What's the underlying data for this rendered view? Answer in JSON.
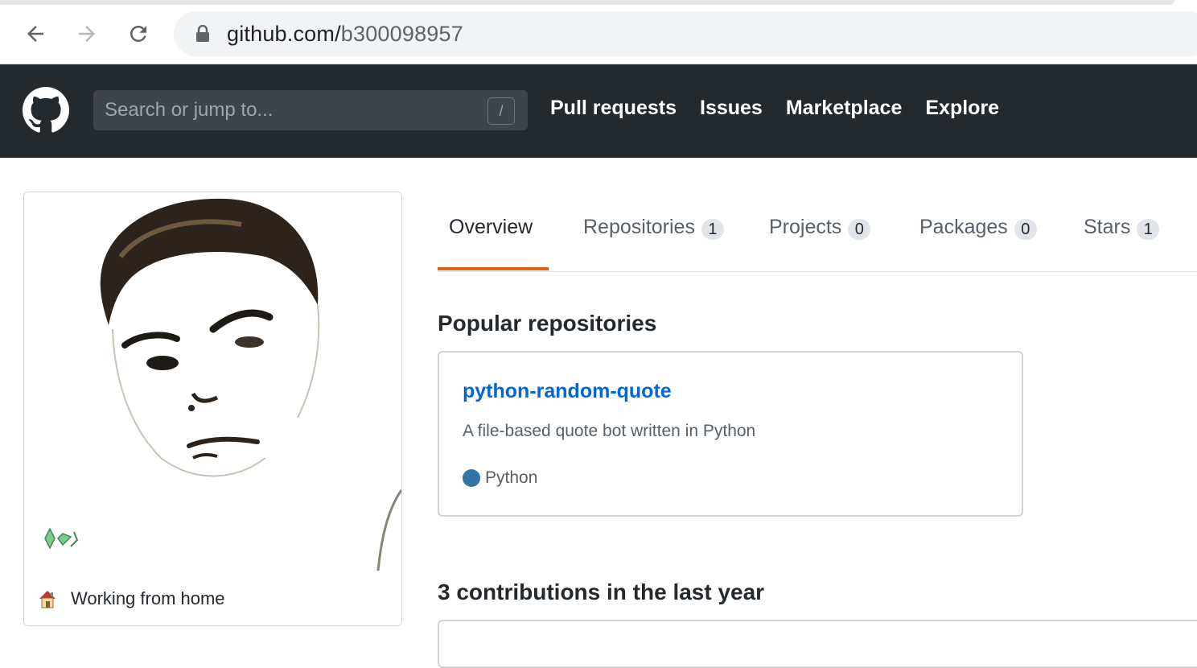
{
  "browser": {
    "url_host": "github.com/",
    "url_path": "b300098957"
  },
  "header": {
    "search_placeholder": "Search or jump to...",
    "search_shortcut": "/",
    "nav": [
      "Pull requests",
      "Issues",
      "Marketplace",
      "Explore"
    ]
  },
  "profile": {
    "status_text": "Working from home"
  },
  "tabs": [
    {
      "label": "Overview",
      "count": null,
      "selected": true
    },
    {
      "label": "Repositories",
      "count": "1"
    },
    {
      "label": "Projects",
      "count": "0"
    },
    {
      "label": "Packages",
      "count": "0"
    },
    {
      "label": "Stars",
      "count": "1"
    }
  ],
  "popular": {
    "title": "Popular repositories",
    "repos": [
      {
        "name": "python-random-quote",
        "description": "A file-based quote bot written in Python",
        "language": "Python",
        "language_color": "#3572A5"
      }
    ]
  },
  "contributions": {
    "title": "3 contributions in the last year"
  },
  "colors": {
    "header_bg": "#24292e",
    "accent_tab": "#e36209",
    "link": "#0366d6"
  }
}
